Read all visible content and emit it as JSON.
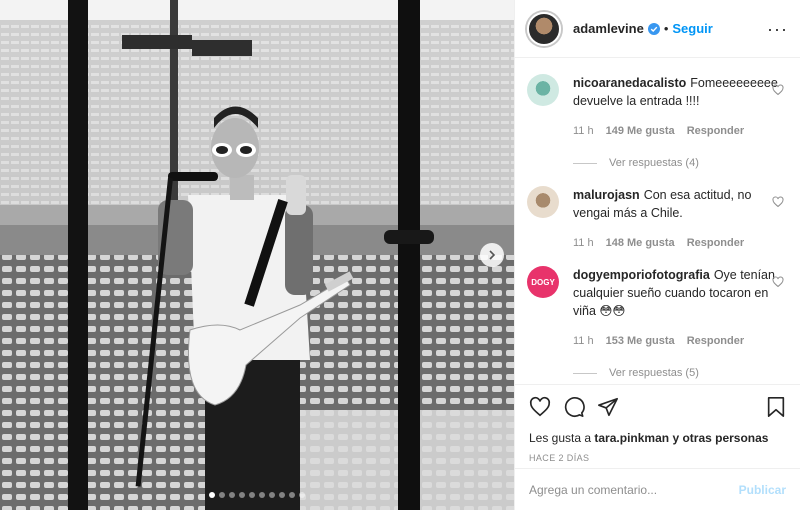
{
  "post": {
    "username": "adamlevine",
    "follow_label": "Seguir",
    "more_label": "···",
    "likes_prefix": "Les gusta a",
    "likes_user": "tara.pinkman",
    "likes_suffix": "y otras personas",
    "timestamp": "HACE 2 DÍAS"
  },
  "comments": [
    {
      "user": "nicoaranedacalisto",
      "text": "Fomeeeeeeeee devuelve la entrada !!!!",
      "time": "11 h",
      "likes": "149 Me gusta",
      "reply": "Responder",
      "view_replies": "Ver respuestas (4)"
    },
    {
      "user": "malurojasn",
      "text": "Con esa actitud, no vengai más a Chile.",
      "time": "11 h",
      "likes": "148 Me gusta",
      "reply": "Responder",
      "view_replies": ""
    },
    {
      "user": "dogyemporiofotografia",
      "text": "Oye tenían cualquier sueño cuando tocaron en viña 😳😳",
      "time": "11 h",
      "likes": "153 Me gusta",
      "reply": "Responder",
      "view_replies": "Ver respuestas (5)",
      "avatar_text": "DOGY"
    }
  ],
  "composer": {
    "placeholder": "Agrega un comentario...",
    "publish_label": "Publicar"
  },
  "carousel": {
    "count": 10,
    "active_index": 0
  },
  "colors": {
    "follow_blue": "#0095f6",
    "publish_disabled": "#b2dffc",
    "dogy_pink": "#e8336b",
    "meta_gray": "#8e8e8e"
  },
  "icons": [
    "verified-badge-icon",
    "heart-icon",
    "comment-icon",
    "share-icon",
    "bookmark-icon",
    "chevron-right-icon",
    "more-options-icon"
  ]
}
